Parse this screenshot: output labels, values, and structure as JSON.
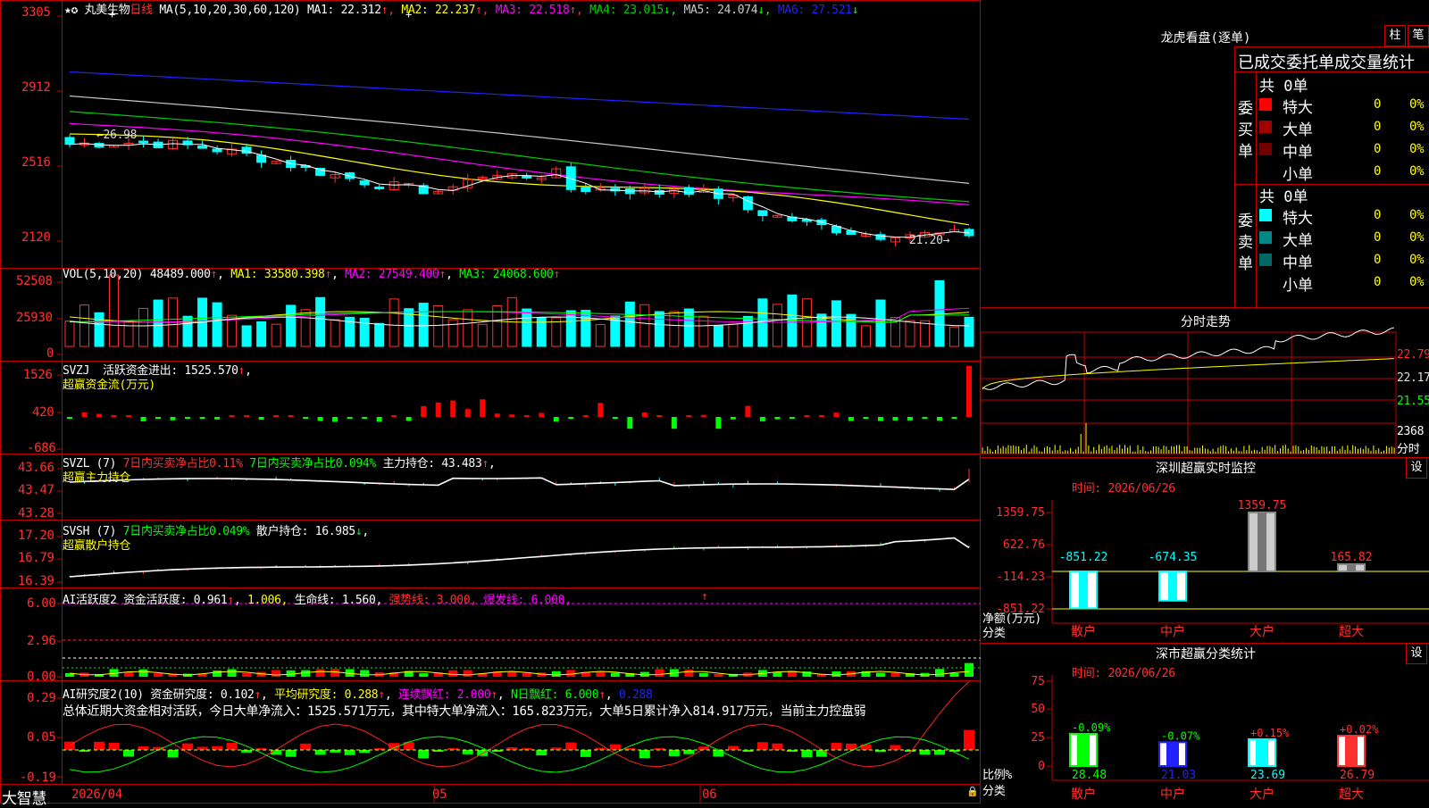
{
  "stock": {
    "name": "丸美生物",
    "period": "日线",
    "ma_label": "MA(5,10,20,30,60,120)",
    "mas": [
      {
        "label": "MA1:",
        "value": "22.312",
        "arrow": "↑",
        "color": "#ffffff"
      },
      {
        "label": "MA2:",
        "value": "22.237",
        "arrow": "↑",
        "color": "#ffff00"
      },
      {
        "label": "MA3:",
        "value": "22.518",
        "arrow": "↑",
        "color": "#ff00ff"
      },
      {
        "label": "MA4:",
        "value": "23.015",
        "arrow": "↓",
        "color": "#00cc00"
      },
      {
        "label": "MA5:",
        "value": "24.074",
        "arrow": "↓",
        "color": "#c8c8c8"
      },
      {
        "label": "MA6:",
        "value": "27.521",
        "arrow": "↓",
        "color": "#2222ff"
      }
    ],
    "price_axis": [
      "3305",
      "2912",
      "2516",
      "2120"
    ],
    "high_mark": "26.98",
    "low_mark": "21.20→"
  },
  "vol": {
    "header": "VOL(5,10,20)",
    "value": "48489.000",
    "ma1": "MA1: 33580.398",
    "ma2": "MA2: 27549.400",
    "ma3": "MA3: 24068.600",
    "arrow": "↑",
    "axis": [
      "52508",
      "25930",
      "0"
    ]
  },
  "svzj": {
    "header": "SVZJ",
    "label": "活跃资金进出: 1525.570",
    "sub": "超赢资金流(万元)",
    "axis": [
      "1526",
      "420",
      "-686"
    ]
  },
  "svzl": {
    "header": "SVZL (7)",
    "t1": "7日内买卖净占比0.11%",
    "t2": "7日内买卖净占比0.094%",
    "t3": "主力持仓: 43.483",
    "sub": "超赢主力持仓",
    "axis": [
      "43.66",
      "43.47",
      "43.28"
    ]
  },
  "svsh": {
    "header": "SVSH (7)",
    "t1": "7日内买卖净占比0.049%",
    "t2": "散户持仓: 16.985",
    "sub": "超赢散户持仓",
    "axis": [
      "17.20",
      "16.79",
      "16.39"
    ]
  },
  "ai1": {
    "header": "AI活跃度2",
    "t1": "资金活跃度: 0.961",
    "t2": "1.006,",
    "t3": "生命线: 1.560,",
    "t4": "强势线: 3.000,",
    "t5": "爆发线: 6.000,",
    "axis": [
      "6.00",
      "2.96",
      "0.00"
    ]
  },
  "ai2": {
    "header": "AI研究度2(10)",
    "t1": "资金研究度: 0.102",
    "t2": "平均研究度: 0.288",
    "t3": "连续飘红: 2.000",
    "t4": "N日飘红: 6.000",
    "t5": "0.288",
    "summary": "总体近期大资金相对活跃，今日大单净流入：1525.571万元，其中特大单净流入：165.823万元，大单5日累计净入814.917万元，当前主力控盘弱",
    "axis": [
      "0.29",
      "0.05",
      "-0.19"
    ]
  },
  "bottom": {
    "brand": "大智慧",
    "dates": [
      "2026/04",
      "05",
      "06"
    ]
  },
  "lhb": {
    "title": "龙虎看盘(逐单)",
    "btn1": "柱",
    "btn2": "笔",
    "tab_label": "已成交委托单成交量统计",
    "buy": {
      "total": "共 0单",
      "side": "委买单",
      "rows": [
        {
          "name": "特大",
          "value": "0",
          "pct": "0%",
          "color": "#ff0000"
        },
        {
          "name": "大单",
          "value": "0",
          "pct": "0%",
          "color": "#a00000"
        },
        {
          "name": "中单",
          "value": "0",
          "pct": "0%",
          "color": "#700000"
        },
        {
          "name": "小单",
          "value": "0",
          "pct": "0%",
          "color": "#000000"
        }
      ]
    },
    "sell": {
      "total": "共 0单",
      "side": "委卖单",
      "rows": [
        {
          "name": "特大",
          "value": "0",
          "pct": "0%",
          "color": "#00ffff"
        },
        {
          "name": "大单",
          "value": "0",
          "pct": "0%",
          "color": "#008888"
        },
        {
          "name": "中单",
          "value": "0",
          "pct": "0%",
          "color": "#006666"
        },
        {
          "name": "小单",
          "value": "0",
          "pct": "0%",
          "color": "#000000"
        }
      ]
    }
  },
  "intraday": {
    "title": "分时走势",
    "axis": [
      "22.79",
      "22.17",
      "21.55"
    ],
    "vol_label": "2368",
    "vol_unit": "分时"
  },
  "sz_monitor": {
    "title": "深圳超赢实时监控",
    "set": "设",
    "time": "时间: 2026/06/26",
    "ylabel": "净额(万元)",
    "xlabel": "分类",
    "axis": [
      "1359.75",
      "622.76",
      "-114.23",
      "-851.22"
    ]
  },
  "sz_class": {
    "title": "深市超赢分类统计",
    "set": "设",
    "time": "时间: 2026/06/26",
    "ylabel": "比例%",
    "xlabel": "分类",
    "axis": [
      "75",
      "50",
      "25",
      "0"
    ]
  },
  "chart_data": [
    {
      "type": "bar",
      "title": "深圳超赢实时监控",
      "categories": [
        "散户",
        "中户",
        "大户",
        "超大"
      ],
      "values": [
        -851.22,
        -674.35,
        1359.75,
        165.82
      ],
      "ylabel": "净额(万元)",
      "xlabel": "分类",
      "ylim": [
        -851.22,
        1359.75
      ]
    },
    {
      "type": "bar",
      "title": "深市超赢分类统计",
      "categories": [
        "散户",
        "中户",
        "大户",
        "超大"
      ],
      "values": [
        28.48,
        21.03,
        23.69,
        26.79
      ],
      "changes": [
        "-0.09%",
        "-0.07%",
        "+0.15%",
        "+0.02%"
      ],
      "ylabel": "比例%",
      "xlabel": "分类",
      "ylim": [
        0,
        75
      ]
    }
  ]
}
